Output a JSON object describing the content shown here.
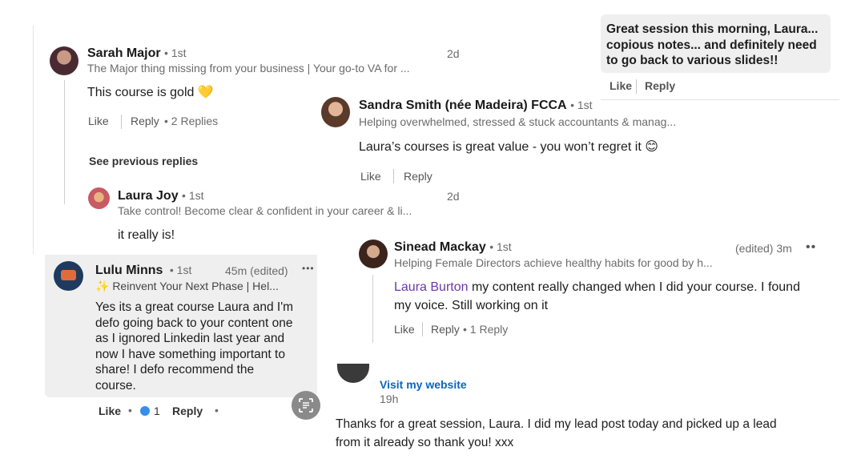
{
  "top_right": {
    "comment": [
      "Great session this morning, Laura...",
      "copious notes... and definitely need",
      "to go back to various slides!!"
    ],
    "like": "Like",
    "reply": "Reply"
  },
  "sarah": {
    "name": "Sarah Major",
    "degree": "• 1st",
    "headline": "The Major thing missing from your business | Your go-to VA for ...",
    "time": "2d",
    "comment": "This course is gold 💛",
    "like": "Like",
    "reply": "Reply",
    "replies": "• 2 Replies",
    "see_previous": "See previous replies"
  },
  "laura_joy": {
    "name": "Laura Joy",
    "degree": "• 1st",
    "headline": "Take control! Become clear & confident in your career & li...",
    "time": "2d",
    "comment": "it really is!"
  },
  "sandra": {
    "name": "Sandra Smith (née Madeira) FCCA",
    "degree": "• 1st",
    "headline": "Helping overwhelmed, stressed & stuck accountants & manag...",
    "comment": "Laura’s courses is great value - you won’t regret it 😊",
    "like": "Like",
    "reply": "Reply"
  },
  "sinead": {
    "name": "Sinead Mackay",
    "degree": "• 1st",
    "headline": "Helping Female Directors achieve healthy habits for good by h...",
    "time": "(edited) 3m",
    "more": "••",
    "mention": "Laura Burton",
    "comment_line1": " my content really changed when I did your course. I found",
    "comment_line2": "my voice. Still working on it",
    "like": "Like",
    "reply": "Reply",
    "replies": "• 1 Reply"
  },
  "lulu": {
    "name": "Lulu Minns",
    "degree": "• 1st",
    "time": "45m (edited)",
    "more": "•••",
    "headline": "✨ Reinvent Your Next Phase | Hel...",
    "comment": [
      "Yes its a great course Laura and I'm",
      "defo going back to your content one",
      "as I ignored Linkedin last year and",
      "now I have something important to",
      "share! I defo recommend the",
      "course."
    ],
    "like": "Like",
    "reaction_count": "1",
    "reply": "Reply"
  },
  "bottom": {
    "visit": "Visit my website",
    "time": "19h",
    "comment_line1": "Thanks for a great session, Laura. I did my lead post today and picked up a lead",
    "comment_line2": "from it already so thank you! xxx"
  },
  "colors": {
    "mention_purple": "#6b37a8",
    "link_blue": "#0a66c2",
    "bubble_gray": "#efefef"
  }
}
